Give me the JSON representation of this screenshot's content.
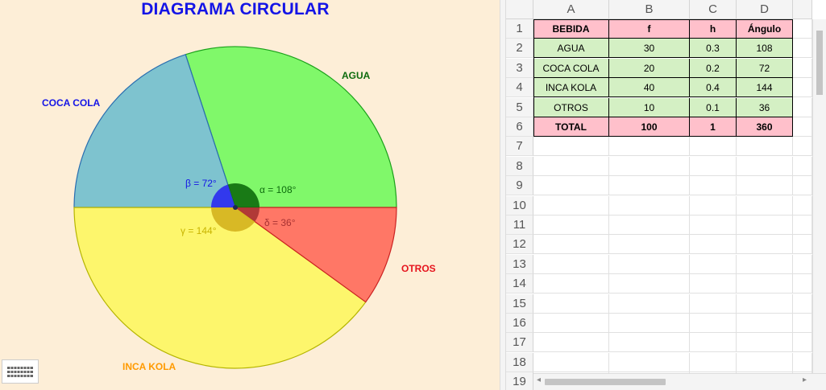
{
  "graphics": {
    "title": "DIAGRAMA CIRCULAR",
    "slice_labels": {
      "agua": "AGUA",
      "coca_cola": "COCA COLA",
      "inca_kola": "INCA KOLA",
      "otros": "OTROS"
    },
    "angle_labels": {
      "alpha": "α = 108°",
      "beta": "β = 72°",
      "gamma": "γ = 144°",
      "delta": "δ = 36°"
    },
    "colors": {
      "agua": "#80f86a",
      "coca_cola": "#7ec3cf",
      "inca_kola": "#fdf66c",
      "otros": "#ff7766",
      "background": "#fdeed7",
      "title": "#1414e6"
    }
  },
  "chart_data": {
    "type": "pie",
    "title": "DIAGRAMA CIRCULAR",
    "slices": [
      {
        "label": "AGUA",
        "value": 108
      },
      {
        "label": "COCA COLA",
        "value": 72
      },
      {
        "label": "INCA KOLA",
        "value": 144
      },
      {
        "label": "OTROS",
        "value": 36
      }
    ]
  },
  "sheet": {
    "columns": [
      "A",
      "B",
      "C",
      "D"
    ],
    "rows": [
      "1",
      "2",
      "3",
      "4",
      "5",
      "6",
      "7",
      "8",
      "9",
      "10",
      "11",
      "12",
      "13",
      "14",
      "15",
      "16",
      "17",
      "18",
      "19"
    ],
    "table": [
      [
        "BEBIDA",
        "f",
        "h",
        "Ángulo"
      ],
      [
        "AGUA",
        "30",
        "0.3",
        "108"
      ],
      [
        "COCA COLA",
        "20",
        "0.2",
        "72"
      ],
      [
        "INCA KOLA",
        "40",
        "0.4",
        "144"
      ],
      [
        "OTROS",
        "10",
        "0.1",
        "36"
      ],
      [
        "TOTAL",
        "100",
        "1",
        "360"
      ]
    ]
  }
}
